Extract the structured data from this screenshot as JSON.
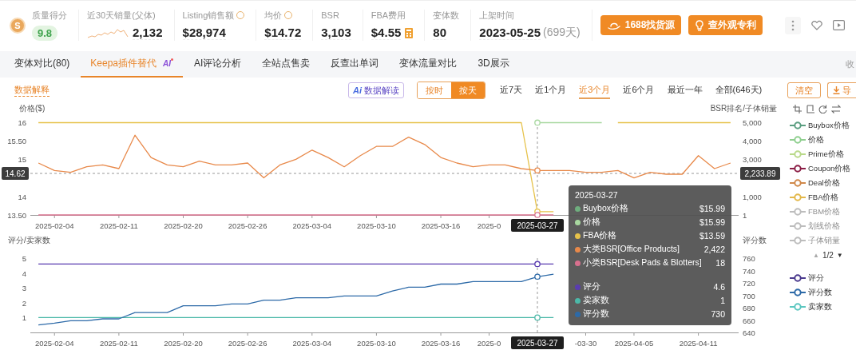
{
  "header": {
    "logo_letter": "S",
    "metrics": [
      {
        "label": "质量得分",
        "value": "9.8",
        "kind": "score",
        "help": false
      },
      {
        "label": "近30天销量(父体)",
        "value": "2,132",
        "kind": "trend",
        "help": false
      },
      {
        "label": "Listing销售额",
        "value": "$28,974",
        "kind": "plain",
        "help": true
      },
      {
        "label": "均价",
        "value": "$14.72",
        "kind": "plain",
        "help": true
      },
      {
        "label": "BSR",
        "value": "3,103",
        "kind": "plain",
        "help": false
      },
      {
        "label": "FBA费用",
        "value": "$4.55",
        "kind": "fee",
        "help": false
      },
      {
        "label": "变体数",
        "value": "80",
        "kind": "plain",
        "help": false
      },
      {
        "label": "上架时间",
        "value": "2023-05-25",
        "note": "(699天)",
        "kind": "plain",
        "help": false
      }
    ],
    "buttons": [
      {
        "label": "1688找货源",
        "kind": "source"
      },
      {
        "label": "查外观专利",
        "kind": "patent"
      }
    ]
  },
  "tabs": [
    {
      "label": "变体对比(80)",
      "selected": false
    },
    {
      "label": "Keepa插件替代",
      "selected": true,
      "badge": "AI"
    },
    {
      "label": "AI评论分析",
      "selected": false
    },
    {
      "label": "全站点售卖",
      "selected": false
    },
    {
      "label": "反查出单词",
      "selected": false
    },
    {
      "label": "变体流量对比",
      "selected": false
    },
    {
      "label": "3D展示",
      "selected": false
    }
  ],
  "tabs_right": "收",
  "toolbar": {
    "explain_link": "数据解释",
    "ai_button": {
      "icon_text": "Ai",
      "label": "数据解读"
    },
    "granularity": [
      {
        "label": "按时",
        "selected": false
      },
      {
        "label": "按天",
        "selected": true
      }
    ],
    "ranges": [
      {
        "label": "近7天",
        "selected": false
      },
      {
        "label": "近1个月",
        "selected": false
      },
      {
        "label": "近3个月",
        "selected": true
      },
      {
        "label": "近6个月",
        "selected": false
      },
      {
        "label": "最近一年",
        "selected": false
      },
      {
        "label": "全部(646天)",
        "selected": false
      }
    ],
    "clear_button": "清空",
    "export_button": "导"
  },
  "price_chart": {
    "left_axis_title": "价格($)",
    "right_axis_title": "BSR排名/子体销量",
    "right_marker_label": "2,233.89",
    "chart_data": {
      "type": "line",
      "ylim": [
        13.5,
        16
      ],
      "y2lim": [
        0,
        5000
      ],
      "categories": [
        null,
        "2025-02-04",
        null,
        null,
        null,
        "2025-02-11",
        null,
        null,
        null,
        "2025-02-20",
        null,
        null,
        null,
        "2025-02-26",
        null,
        null,
        null,
        "2025-03-04",
        null,
        null,
        null,
        "2025-03-10",
        null,
        null,
        null,
        "2025-03-16",
        null,
        null,
        "2025-0",
        null,
        null,
        "2025-03-27",
        null,
        null,
        null,
        null,
        null,
        null,
        null,
        null,
        null,
        null,
        null,
        null
      ],
      "yticks": [
        {
          "value": 16,
          "label": "16"
        },
        {
          "value": 15.5,
          "label": "15.50"
        },
        {
          "value": 15,
          "label": "15"
        },
        {
          "value": 14,
          "label": "14"
        },
        {
          "value": 13.5,
          "label": "13.50"
        }
      ],
      "y2ticks": [
        {
          "value": 5000,
          "label": "5,000"
        },
        {
          "value": 4000,
          "label": "4,000"
        },
        {
          "value": 3000,
          "label": "3,000"
        },
        {
          "value": 1000,
          "label": "1,000"
        },
        {
          "value": 1,
          "label": "1"
        }
      ],
      "series": [
        {
          "name": "Buybox价格",
          "color": "#6fae7e",
          "values": [
            null,
            null,
            null,
            null,
            null,
            null,
            null,
            null,
            null,
            null,
            null,
            null,
            null,
            null,
            null,
            null,
            null,
            null,
            null,
            null,
            null,
            null,
            null,
            null,
            null,
            null,
            null,
            null,
            null,
            null,
            null,
            null,
            null,
            null,
            null,
            null,
            null,
            null,
            null,
            null,
            null,
            null,
            null,
            null
          ]
        },
        {
          "name": "价格",
          "color": "#a8d8a0",
          "values": [
            null,
            null,
            null,
            null,
            null,
            null,
            null,
            null,
            null,
            null,
            null,
            null,
            null,
            null,
            null,
            null,
            null,
            null,
            null,
            null,
            null,
            null,
            null,
            null,
            null,
            null,
            null,
            null,
            null,
            null,
            null,
            15.99,
            15.99,
            15.99,
            15.99,
            15.99,
            null,
            null,
            null,
            null,
            null,
            null,
            null,
            null
          ]
        },
        {
          "name": "FBA价格",
          "color": "#e6c24a",
          "values": [
            15.99,
            15.99,
            15.99,
            15.99,
            15.99,
            15.99,
            15.99,
            15.99,
            15.99,
            15.99,
            15.99,
            15.99,
            15.99,
            15.99,
            15.99,
            15.99,
            15.99,
            15.99,
            15.99,
            15.99,
            15.99,
            15.99,
            15.99,
            15.99,
            15.99,
            15.99,
            15.99,
            15.99,
            15.99,
            15.99,
            15.99,
            13.59,
            13.59,
            null,
            null,
            null,
            15.99,
            15.99,
            15.99,
            15.99,
            15.99,
            15.99,
            15.99,
            15.99
          ]
        },
        {
          "name": "大类BSR[Office Products]",
          "color": "#e8894a",
          "axis": "y2",
          "values": [
            2800,
            2400,
            2300,
            2600,
            2700,
            2500,
            4300,
            3100,
            2700,
            2600,
            2900,
            2700,
            2700,
            2800,
            2000,
            2700,
            3000,
            3500,
            3100,
            2600,
            3200,
            3700,
            3700,
            4200,
            3800,
            3100,
            2800,
            2600,
            2700,
            2700,
            2500,
            2400,
            2400,
            2400,
            2300,
            2300,
            2400,
            2000,
            2300,
            2200,
            2200,
            3200,
            2500,
            2800
          ]
        },
        {
          "name": "小类BSR[Desk Pads & Blotters]",
          "color": "#d8708e",
          "axis": "y2",
          "values": [
            0,
            0,
            0,
            0,
            0,
            0,
            0,
            0,
            0,
            0,
            0,
            0,
            0,
            0,
            0,
            0,
            0,
            0,
            0,
            0,
            0,
            0,
            0,
            0,
            0,
            0,
            0,
            0,
            0,
            0,
            0,
            0,
            0,
            null,
            null,
            null,
            null,
            null,
            null,
            null,
            null,
            null,
            null,
            null
          ]
        }
      ],
      "ref_lines": [
        {
          "axis": "y",
          "value": 14.62,
          "label": "14.62"
        },
        {
          "axis": "x",
          "value": "2025-03-27"
        }
      ]
    },
    "legend": [
      {
        "label": "Buybox价格",
        "on": true,
        "color": "#5a9e80"
      },
      {
        "label": "价格",
        "on": true,
        "color": "#8fcf8f"
      },
      {
        "label": "Prime价格",
        "on": true,
        "color": "#b9d98a"
      },
      {
        "label": "Coupon价格",
        "on": true,
        "color": "#8b1e46"
      },
      {
        "label": "Deal价格",
        "on": true,
        "color": "#d0894a"
      },
      {
        "label": "FBA价格",
        "on": true,
        "color": "#e3b84a"
      },
      {
        "label": "FBM价格",
        "on": false
      },
      {
        "label": "划线价格",
        "on": false
      },
      {
        "label": "子体销量",
        "on": false
      }
    ],
    "legend_pager": {
      "prev": "▲",
      "page": "1/2",
      "next": "▼"
    }
  },
  "rating_chart": {
    "left_axis_title": "评分/卖家数",
    "right_axis_title": "评分数",
    "chart_data": {
      "type": "line",
      "ylim": [
        0,
        5
      ],
      "y2lim": [
        640,
        760
      ],
      "categories": [
        null,
        "2025-02-04",
        null,
        null,
        null,
        "2025-02-11",
        null,
        null,
        null,
        "2025-02-20",
        null,
        null,
        null,
        "2025-02-26",
        null,
        null,
        null,
        "2025-03-04",
        null,
        null,
        null,
        "2025-03-10",
        null,
        null,
        null,
        "2025-03-16",
        null,
        null,
        "2025-0",
        null,
        null,
        "2025-03-27",
        null,
        null,
        "-03-30",
        null,
        null,
        "2025-04-05",
        null,
        null,
        null,
        "2025-04-11",
        null,
        null
      ],
      "yticks": [
        {
          "value": 5,
          "label": "5"
        },
        {
          "value": 4,
          "label": "4"
        },
        {
          "value": 3,
          "label": "3"
        },
        {
          "value": 2,
          "label": "2"
        },
        {
          "value": 1,
          "label": "1"
        }
      ],
      "y2ticks": [
        {
          "value": 760,
          "label": "760"
        },
        {
          "value": 740,
          "label": "740"
        },
        {
          "value": 720,
          "label": "720"
        },
        {
          "value": 700,
          "label": "700"
        },
        {
          "value": 680,
          "label": "680"
        },
        {
          "value": 660,
          "label": "660"
        },
        {
          "value": 640,
          "label": "640"
        }
      ],
      "series": [
        {
          "name": "评分",
          "color": "#5a3cb0",
          "values": [
            4.6,
            4.6,
            4.6,
            4.6,
            4.6,
            4.6,
            4.6,
            4.6,
            4.6,
            4.6,
            4.6,
            4.6,
            4.6,
            4.6,
            4.6,
            4.6,
            4.6,
            4.6,
            4.6,
            4.6,
            4.6,
            4.6,
            4.6,
            4.6,
            4.6,
            4.6,
            4.6,
            4.6,
            4.6,
            4.6,
            4.6,
            4.6,
            4.6,
            null,
            null,
            null,
            null,
            null,
            null,
            null,
            null,
            null,
            null,
            null
          ]
        },
        {
          "name": "卖家数",
          "color": "#4cb8a8",
          "values": [
            1,
            1,
            1,
            1,
            1,
            1,
            1,
            1,
            1,
            1,
            1,
            1,
            1,
            1,
            1,
            1,
            1,
            1,
            1,
            1,
            1,
            1,
            1,
            1,
            1,
            1,
            1,
            1,
            1,
            1,
            1,
            1,
            1,
            null,
            null,
            null,
            null,
            null,
            null,
            null,
            null,
            null,
            null,
            null
          ]
        },
        {
          "name": "评分数",
          "color": "#2d6aa8",
          "axis": "y2",
          "values": [
            652,
            655,
            659,
            659,
            662,
            662,
            672,
            672,
            672,
            683,
            683,
            683,
            686,
            686,
            692,
            692,
            696,
            696,
            696,
            699,
            699,
            699,
            707,
            713,
            713,
            718,
            718,
            722,
            722,
            722,
            722,
            730,
            734,
            null,
            null,
            null,
            null,
            null,
            null,
            null,
            null,
            null,
            null,
            null
          ]
        }
      ],
      "ref_lines": [
        {
          "axis": "x",
          "value": "2025-03-27"
        }
      ]
    },
    "legend": [
      {
        "label": "评分",
        "on": true,
        "color": "#4b3a8e"
      },
      {
        "label": "评分数",
        "on": true,
        "color": "#2d6aa8"
      },
      {
        "label": "卖家数",
        "on": true,
        "color": "#5cc7c0"
      }
    ]
  },
  "tooltip": {
    "date": "2025-03-27",
    "groups": [
      {
        "rows": [
          {
            "value": "$15.99"
          },
          {
            "value": "$15.99"
          },
          {
            "value": "$13.59"
          },
          {
            "value": "2,422"
          },
          {
            "value": "18"
          }
        ]
      },
      {
        "rows": [
          {
            "value": "4.6"
          },
          {
            "value": "1"
          },
          {
            "value": "730"
          }
        ]
      }
    ]
  }
}
